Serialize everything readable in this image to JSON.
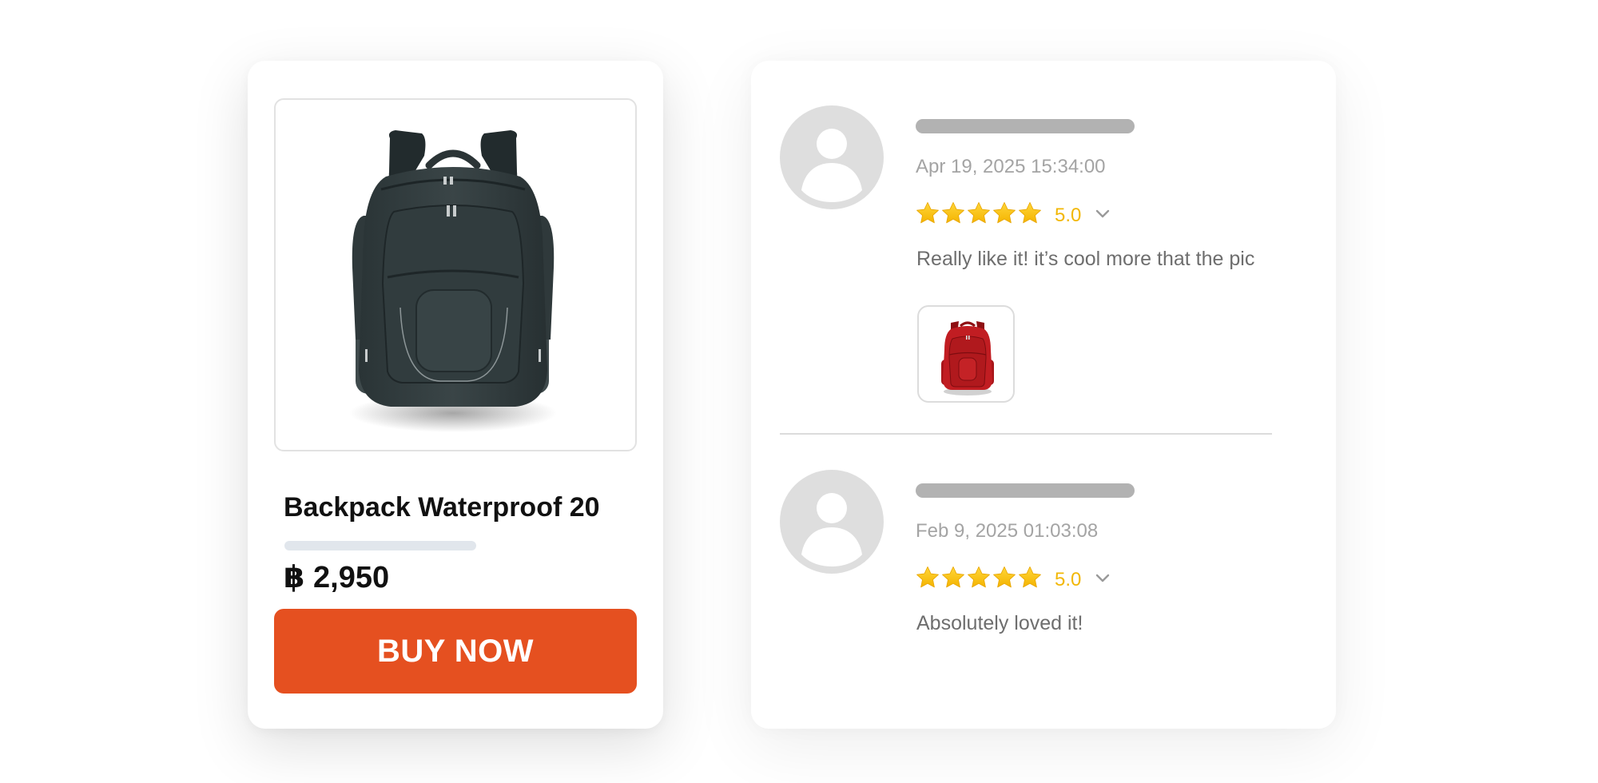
{
  "product": {
    "title": "Backpack Waterproof 20",
    "price": "฿ 2,950",
    "buy_label": "BUY NOW",
    "image_icon": "black-backpack-image"
  },
  "reviews": [
    {
      "date": "Apr 19, 2025  15:34:00",
      "rating": 5,
      "score": "5.0",
      "text": "Really like it! it’s cool more that the pic",
      "photo_icon": "red-backpack-image"
    },
    {
      "date": "Feb 9, 2025  01:03:08",
      "rating": 5,
      "score": "5.0",
      "text": "Absolutely loved it!"
    }
  ],
  "colors": {
    "accent": "#e55020",
    "star": "#f8c20a",
    "score": "#f2b705",
    "avatar": "#dedede",
    "placeholder_bar": "#b2b2b2"
  }
}
